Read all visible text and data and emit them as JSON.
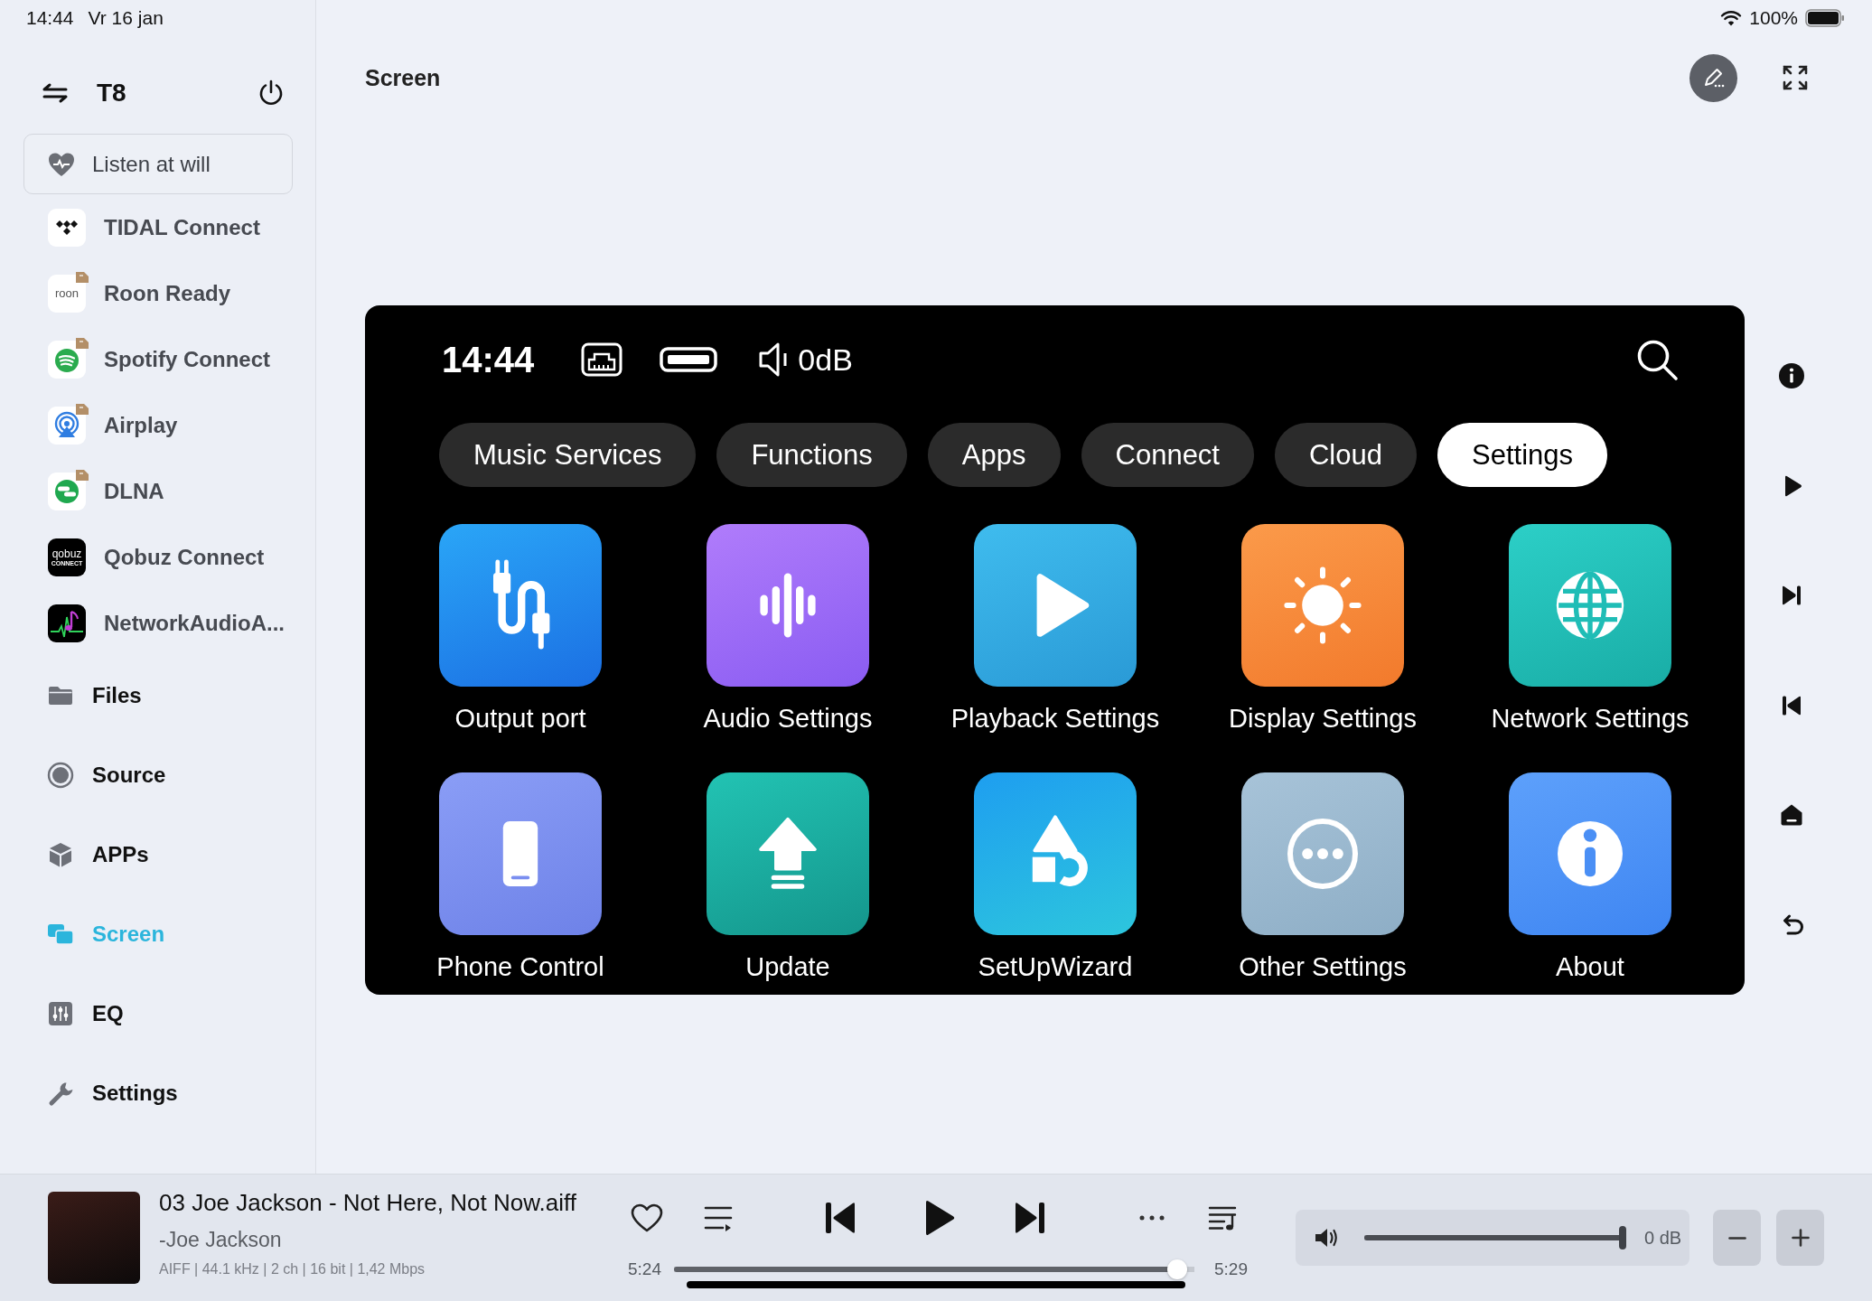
{
  "status_bar": {
    "time": "14:44",
    "date": "Vr 16 jan",
    "battery": "100%"
  },
  "sidebar": {
    "device": "T8",
    "promo": {
      "label": "Listen at will"
    },
    "services": [
      {
        "label": "TIDAL Connect",
        "kind": "tidal",
        "tagged": false
      },
      {
        "label": "Roon Ready",
        "kind": "roon",
        "logo_text": "roon",
        "tagged": true
      },
      {
        "label": "Spotify Connect",
        "kind": "spotify",
        "tagged": true
      },
      {
        "label": "Airplay",
        "kind": "airplay",
        "tagged": true
      },
      {
        "label": "DLNA",
        "kind": "dlna",
        "tagged": true
      },
      {
        "label": "Qobuz Connect",
        "kind": "qobuz",
        "logo_text": "qobuz",
        "logo_subtext": "CONNECT",
        "tagged": false
      },
      {
        "label": "NetworkAudioA...",
        "kind": "networkaudio",
        "tagged": false
      }
    ],
    "nav_items": [
      {
        "label": "Files",
        "kind": "files",
        "selected": false
      },
      {
        "label": "Source",
        "kind": "source",
        "selected": false
      },
      {
        "label": "APPs",
        "kind": "apps",
        "selected": false
      },
      {
        "label": "Screen",
        "kind": "screen",
        "selected": true
      },
      {
        "label": "EQ",
        "kind": "eq",
        "selected": false
      },
      {
        "label": "Settings",
        "kind": "settings",
        "selected": false
      }
    ]
  },
  "header": {
    "title": "Screen"
  },
  "device_screen": {
    "time": "14:44",
    "volume": "0dB",
    "tabs": [
      {
        "label": "Music Services",
        "selected": false
      },
      {
        "label": "Functions",
        "selected": false
      },
      {
        "label": "Apps",
        "selected": false
      },
      {
        "label": "Connect",
        "selected": false
      },
      {
        "label": "Cloud",
        "selected": false
      },
      {
        "label": "Settings",
        "selected": true
      }
    ],
    "apps": [
      {
        "label": "Output port",
        "kind": "output"
      },
      {
        "label": "Audio Settings",
        "kind": "audio"
      },
      {
        "label": "Playback Settings",
        "kind": "playback"
      },
      {
        "label": "Display Settings",
        "kind": "display"
      },
      {
        "label": "Network Settings",
        "kind": "network"
      },
      {
        "label": "Phone Control",
        "kind": "phone"
      },
      {
        "label": "Update",
        "kind": "update"
      },
      {
        "label": "SetUpWizard",
        "kind": "setup"
      },
      {
        "label": "Other Settings",
        "kind": "other"
      },
      {
        "label": "About",
        "kind": "about"
      }
    ]
  },
  "player": {
    "title": "03 Joe Jackson - Not Here, Not Now.aiff",
    "artist": "-Joe Jackson",
    "format": "AIFF | 44.1 kHz | 2 ch | 16 bit | 1,42 Mbps",
    "elapsed": "5:24",
    "duration": "5:29",
    "progress": {
      "level": 0.985
    },
    "volume": {
      "level": 1,
      "reading": "0 dB"
    }
  }
}
